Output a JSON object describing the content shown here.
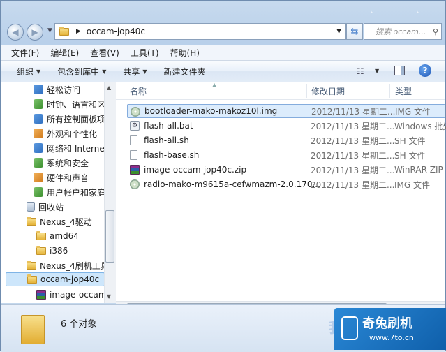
{
  "address": {
    "path": "occam-jop40c"
  },
  "search": {
    "placeholder": "搜索 occam..."
  },
  "menu": [
    "文件(F)",
    "编辑(E)",
    "查看(V)",
    "工具(T)",
    "帮助(H)"
  ],
  "toolbar": {
    "organize": "组织",
    "include_in_library": "包含到库中",
    "share": "共享",
    "new_folder": "新建文件夹"
  },
  "nav": {
    "cp_items": [
      "轻松访问",
      "时钟、语言和区",
      "所有控制面板项",
      "外观和个性化",
      "网络和 Internet",
      "系统和安全",
      "硬件和声音",
      "用户帐户和家庭"
    ],
    "recycle": "回收站",
    "nexus_driver": "Nexus_4驱动",
    "amd64": "amd64",
    "i386": "i386",
    "nexus_flash_tool": "Nexus_4刷机工具",
    "occam": "occam-jop40c",
    "image_occam": "image-occam-",
    "office": "办公"
  },
  "columns": {
    "name": "名称",
    "date": "修改日期",
    "type": "类型"
  },
  "files": [
    {
      "name": "bootloader-mako-makoz10l.img",
      "date": "2012/11/13 星期二...",
      "type": "IMG 文件",
      "icon": "disc-image-icon"
    },
    {
      "name": "flash-all.bat",
      "date": "2012/11/13 星期二...",
      "type": "Windows 批处",
      "icon": "batch-file-icon"
    },
    {
      "name": "flash-all.sh",
      "date": "2012/11/13 星期二...",
      "type": "SH 文件",
      "icon": "document-icon"
    },
    {
      "name": "flash-base.sh",
      "date": "2012/11/13 星期二...",
      "type": "SH 文件",
      "icon": "document-icon"
    },
    {
      "name": "image-occam-jop40c.zip",
      "date": "2012/11/13 星期二...",
      "type": "WinRAR ZIP",
      "icon": "winrar-archive-icon"
    },
    {
      "name": "radio-mako-m9615a-cefwmazm-2.0.170...",
      "date": "2012/11/13 星期二...",
      "type": "IMG 文件",
      "icon": "disc-image-icon"
    }
  ],
  "status": {
    "count": "6 个对象"
  },
  "watermark": {
    "ghost": "我",
    "title": "奇兔刷机",
    "url": "www.7to.cn"
  }
}
